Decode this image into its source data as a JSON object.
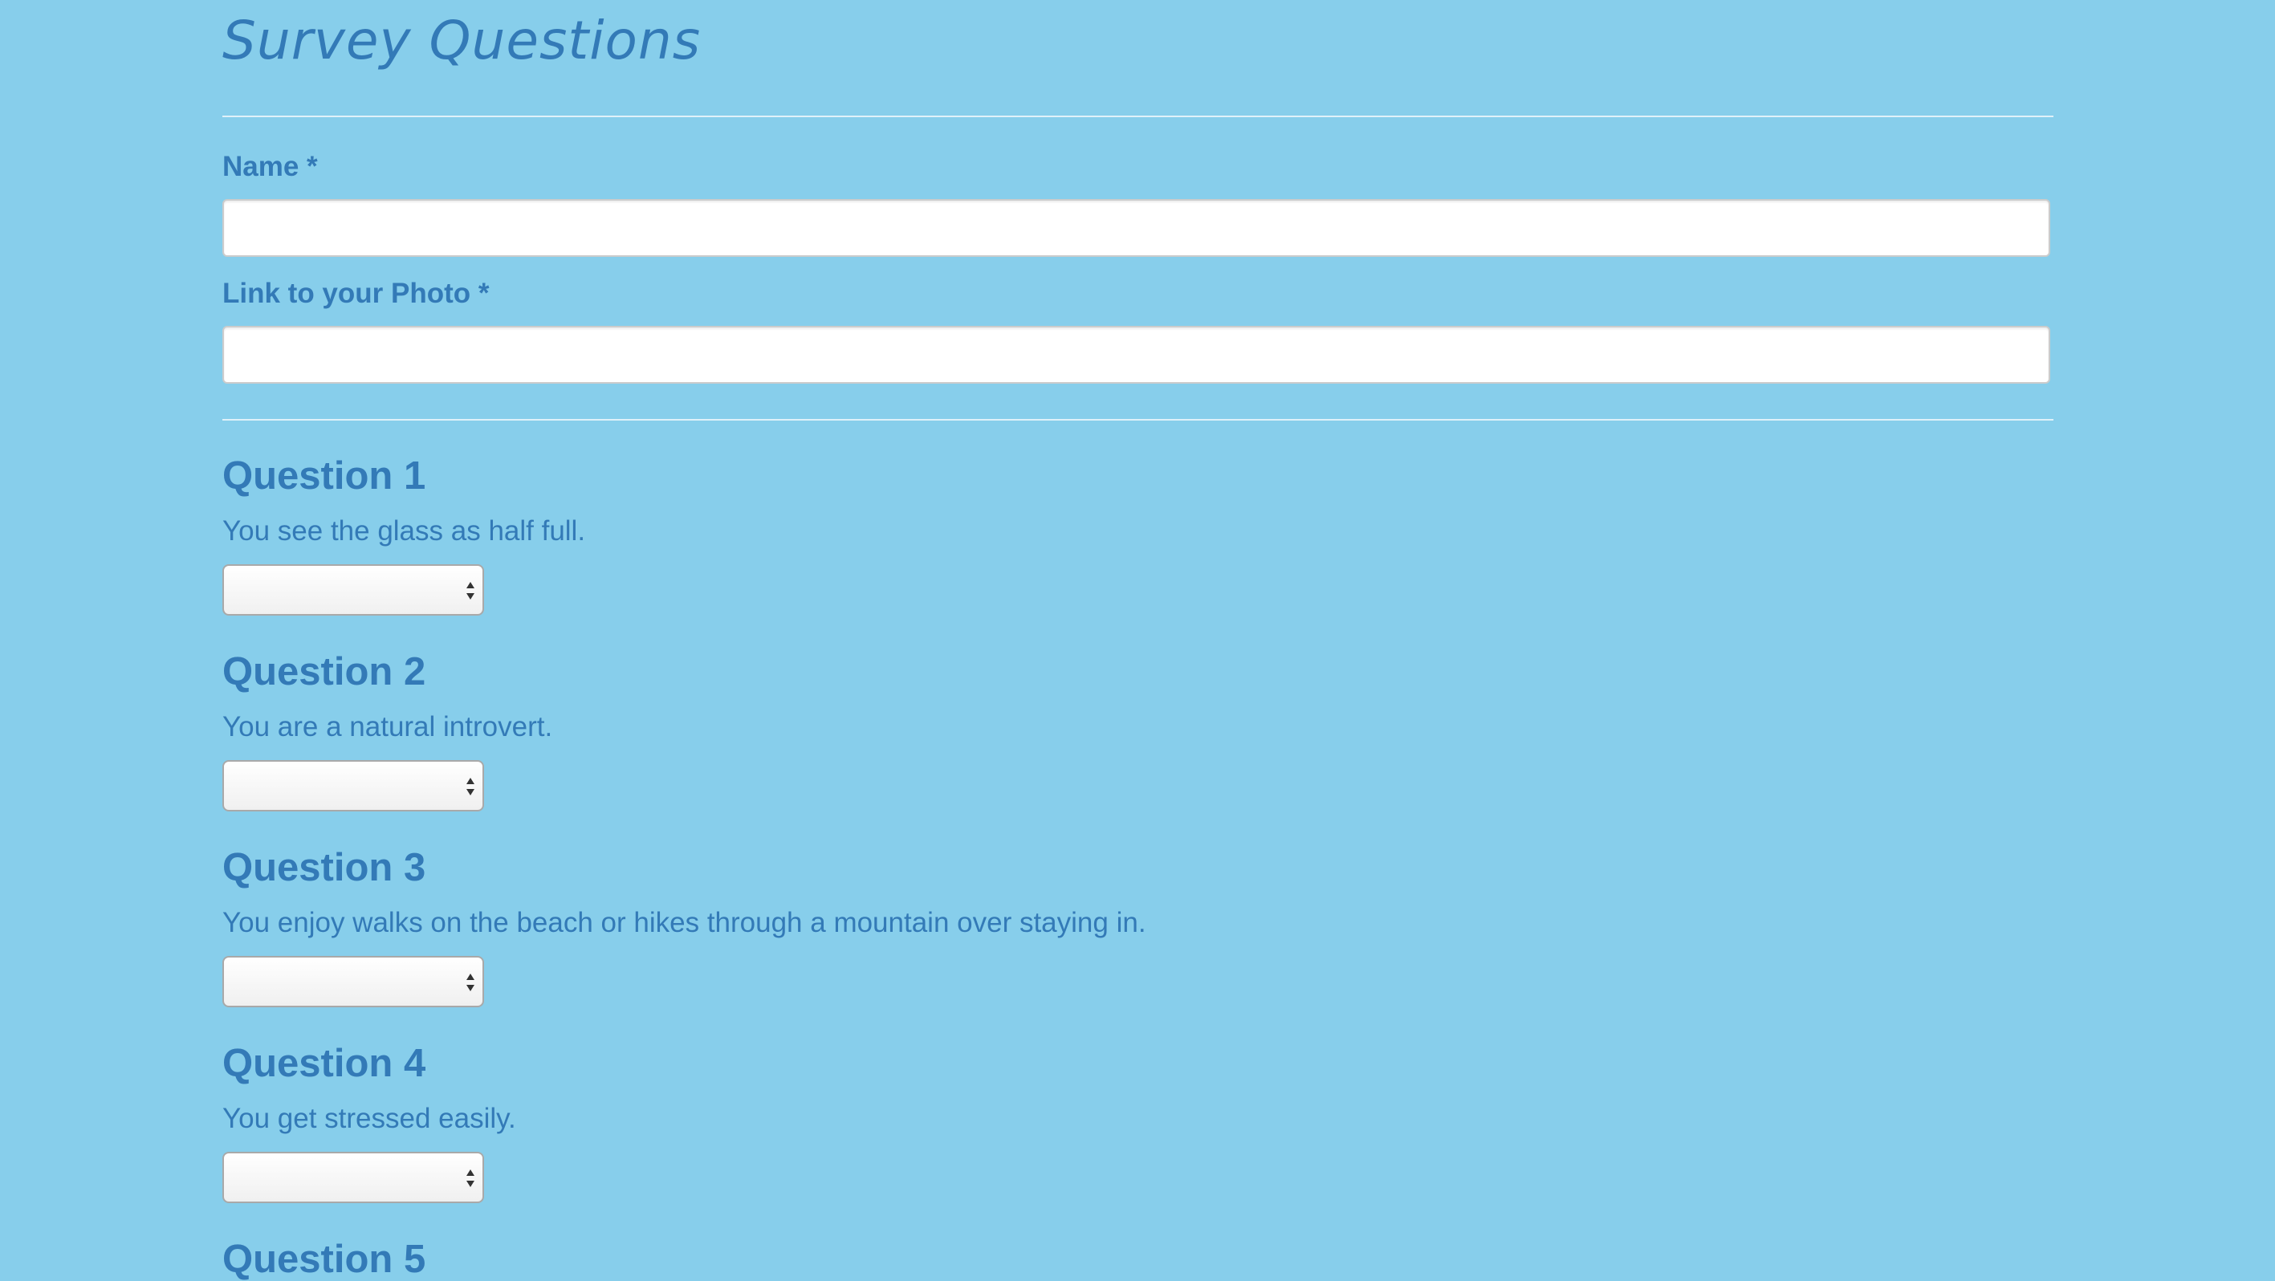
{
  "page": {
    "title": "Survey Questions"
  },
  "form": {
    "name_label": "Name *",
    "name_value": "",
    "photo_label": "Link to your Photo *",
    "photo_value": ""
  },
  "questions": [
    {
      "heading": "Question 1",
      "text": "You see the glass as half full.",
      "selected": ""
    },
    {
      "heading": "Question 2",
      "text": "You are a natural introvert.",
      "selected": ""
    },
    {
      "heading": "Question 3",
      "text": "You enjoy walks on the beach or hikes through a mountain over staying in.",
      "selected": ""
    },
    {
      "heading": "Question 4",
      "text": "You get stressed easily.",
      "selected": ""
    },
    {
      "heading": "Question 5"
    }
  ],
  "colors": {
    "background": "#87ceeb",
    "text": "#337ab7",
    "divider": "#dff1f9",
    "input_bg": "#ffffff"
  },
  "icons": {
    "select_indicator": "chevron-updown-icon"
  }
}
